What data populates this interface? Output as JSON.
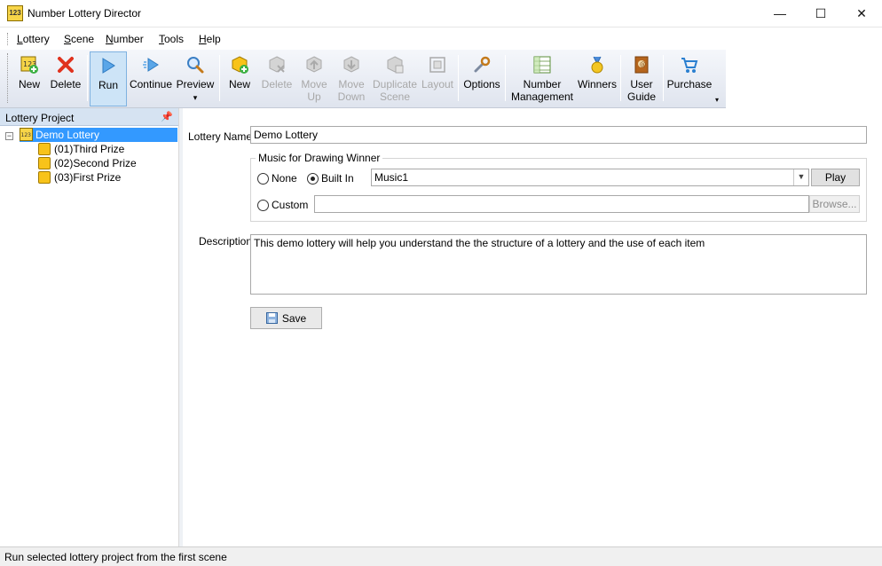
{
  "window": {
    "title": "Number Lottery Director",
    "app_icon_text": "123",
    "minimize": "—",
    "maximize": "☐",
    "close": "✕"
  },
  "menu": [
    "Lottery",
    "Scene",
    "Number",
    "Tools",
    "Help"
  ],
  "menu_mnemonic_first": [
    "L",
    "S",
    "N",
    "T",
    "H"
  ],
  "menu_rest": [
    "ottery",
    "cene",
    "umber",
    "ools",
    "elp"
  ],
  "toolbar": {
    "new_lottery": "New",
    "delete_lottery": "Delete",
    "run": "Run",
    "continue": "Continue",
    "preview": "Preview",
    "preview_dropdown": "▾",
    "new_scene": "New",
    "delete_scene": "Delete",
    "move_up": [
      "Move",
      "Up"
    ],
    "move_down": [
      "Move",
      "Down"
    ],
    "duplicate_scene": [
      "Duplicate",
      "Scene"
    ],
    "layout": "Layout",
    "options": "Options",
    "number_management": [
      "Number",
      "Management"
    ],
    "winners": "Winners",
    "user_guide": [
      "User",
      "Guide"
    ],
    "purchase": "Purchase",
    "overflow": "▾"
  },
  "panel": {
    "title": "Lottery Project",
    "pin": "📌",
    "expander": "−",
    "root": "Demo Lottery",
    "children": [
      "(01)Third Prize",
      "(02)Second Prize",
      "(03)First Prize"
    ]
  },
  "form": {
    "name_label": "Lottery Name",
    "name_value": "Demo Lottery",
    "music_group": "Music for Drawing Winner",
    "radio_none": "None",
    "radio_builtin": "Built In",
    "radio_custom": "Custom",
    "music_selected": "Music1",
    "play": "Play",
    "custom_path": "",
    "browse": "Browse...",
    "description_label": "Description",
    "description_value": "This demo lottery will help you understand the the structure of a lottery and the use of each item",
    "save": "Save"
  },
  "status": "Run selected lottery project from the first scene",
  "colors": {
    "selection": "#3399ff",
    "panel_header": "#d6e3f2",
    "toolbar_active": "#cde4f7"
  }
}
